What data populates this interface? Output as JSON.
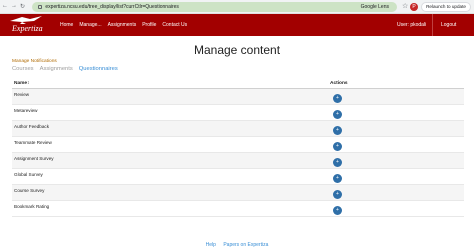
{
  "browser": {
    "url": "expertiza.ncsu.edu/tree_display/list?currCtlr=Questionnaires",
    "lens_label": "Google Lens",
    "profile_initial": "P",
    "relaunch_label": "Relaunch to update"
  },
  "nav": {
    "logo_text": "Expertiza",
    "links": [
      "Home",
      "Manage...",
      "Assignments",
      "Profile",
      "Contact Us"
    ],
    "user_label": "User: pkodali",
    "logout_label": "Logout"
  },
  "page": {
    "title": "Manage content",
    "manage_notifications": "Manage Notifications",
    "tabs": [
      {
        "label": "Courses",
        "active": false
      },
      {
        "label": "Assignments",
        "active": false
      },
      {
        "label": "Questionnaires",
        "active": true
      }
    ]
  },
  "table": {
    "headers": {
      "name": "Name",
      "sort_icon": "↕",
      "actions": "Actions"
    },
    "rows": [
      "Review",
      "Metareview",
      "Author Feedback",
      "Teammate Review",
      "Assignment Survey",
      "Global Survey",
      "Course Survey",
      "Bookmark Rating"
    ],
    "action_symbol": "+"
  },
  "footer": {
    "links": [
      "Help",
      "Papers on Expertiza"
    ]
  },
  "colors": {
    "nav_bg": "#a20000",
    "accent": "#3a8fd6",
    "action_button": "#2f6fa8"
  }
}
